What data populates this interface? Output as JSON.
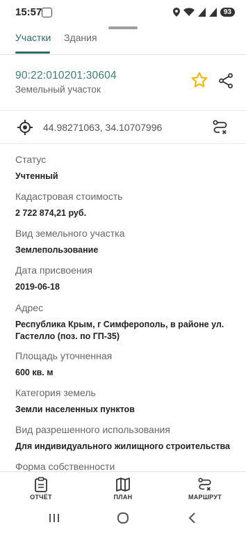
{
  "status_bar": {
    "time": "15:57",
    "battery": "93"
  },
  "tabs": [
    {
      "label": "Участки",
      "active": true
    },
    {
      "label": "Здания",
      "active": false
    }
  ],
  "parcel": {
    "cadastral_number": "90:22:010201:30604",
    "type": "Земельный участок"
  },
  "coordinates": {
    "text": "44.98271063, 34.10707996"
  },
  "properties": [
    {
      "label": "Статус",
      "value": "Учтенный"
    },
    {
      "label": "Кадастровая стоимость",
      "value": "2 722 874,21 руб."
    },
    {
      "label": "Вид земельного участка",
      "value": "Землепользование"
    },
    {
      "label": "Дата присвоения",
      "value": "2019-06-18"
    },
    {
      "label": "Адрес",
      "value": "Республика Крым, г Симферополь, в районе ул. Гастелло (поз. по ГП-35)"
    },
    {
      "label": "Площадь уточненная",
      "value": "600 кв. м"
    },
    {
      "label": "Категория земель",
      "value": "Земли населенных пунктов"
    },
    {
      "label": "Вид разрешенного использования",
      "value": "Для индивидуального жилищного строительства"
    },
    {
      "label": "Форма собственности",
      "value": ""
    }
  ],
  "bottom_nav": [
    {
      "label": "ОТЧЁТ",
      "icon": "report-icon"
    },
    {
      "label": "ПЛАН",
      "icon": "map-icon"
    },
    {
      "label": "МАРШРУТ",
      "icon": "route-icon"
    }
  ],
  "colors": {
    "accent": "#2e6b63",
    "cadastral": "#3d7e76",
    "star": "#f2b705"
  }
}
